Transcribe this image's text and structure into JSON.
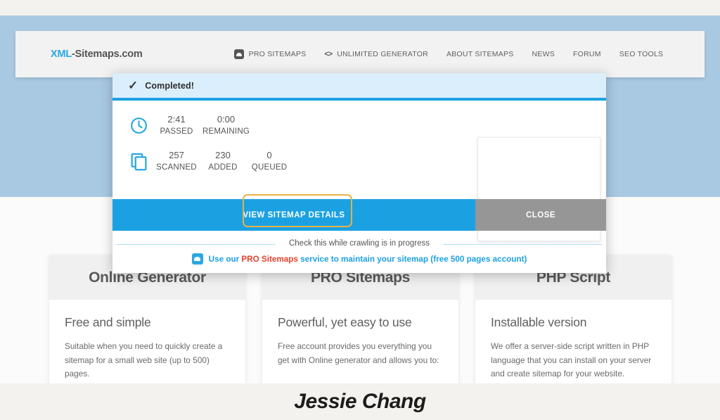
{
  "site": {
    "logo_xml": "XML",
    "logo_rest": "-Sitemaps.com",
    "nav": [
      {
        "label": "PRO SITEMAPS",
        "icon": "upload-box-icon"
      },
      {
        "label": "UNLIMITED GENERATOR",
        "icon": "code-brackets-icon"
      },
      {
        "label": "ABOUT SITEMAPS",
        "icon": ""
      },
      {
        "label": "NEWS",
        "icon": ""
      },
      {
        "label": "FORUM",
        "icon": ""
      },
      {
        "label": "SEO TOOLS",
        "icon": ""
      }
    ],
    "nav_code_glyph": "<>"
  },
  "modal": {
    "status_icon": "✓",
    "title": "Completed!",
    "progress_percent": 100,
    "stats": [
      {
        "icon": "clock-icon",
        "items": [
          {
            "value": "2:41",
            "label": "PASSED"
          },
          {
            "value": "0:00",
            "label": "REMAINING"
          }
        ]
      },
      {
        "icon": "pages-copy-icon",
        "items": [
          {
            "value": "257",
            "label": "SCANNED"
          },
          {
            "value": "230",
            "label": "ADDED"
          },
          {
            "value": "0",
            "label": "QUEUED"
          }
        ]
      }
    ],
    "buttons": {
      "view_details": "VIEW SITEMAP DETAILS",
      "close": "CLOSE"
    },
    "highlight_color": "#e8b145",
    "footer": {
      "crawl_note": "Check this while crawling is in progress",
      "pro_line_prefix": "Use our ",
      "pro_line_brand": "PRO Sitemaps",
      "pro_line_suffix": " service to maintain your sitemap (free 500 pages account)",
      "pro_icon": "upload-box-icon"
    }
  },
  "cards": [
    {
      "title": "Online Generator",
      "subtitle": "Free and simple",
      "text": "Suitable when you need to quickly create a sitemap for a small web site (up to 500) pages."
    },
    {
      "title": "PRO Sitemaps",
      "subtitle": "Powerful, yet easy to use",
      "text": "Free account provides you everything you get with Online generator and allows you to:"
    },
    {
      "title": "PHP Script",
      "subtitle": "Installable version",
      "text": "We offer a server-side script written in PHP language that you can install on your server and create sitemap for your website."
    }
  ],
  "signature": "Jessie Chang",
  "colors": {
    "accent_blue": "#1ba1e2",
    "logo_blue": "#29a8e0",
    "page_blue_bg": "#a9c9e3",
    "close_gray": "#969696",
    "highlight_gold": "#e8b145",
    "brand_red": "#e8412a"
  }
}
